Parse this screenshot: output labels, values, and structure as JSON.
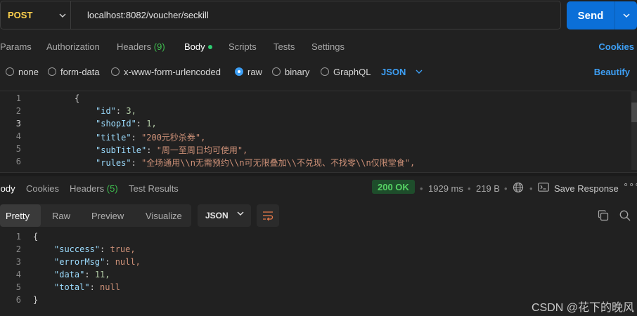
{
  "request": {
    "method": "POST",
    "url": "localhost:8082/voucher/seckill",
    "send_label": "Send"
  },
  "request_tabs": {
    "params": "Params",
    "authorization": "Authorization",
    "headers": "Headers",
    "headers_count": "(9)",
    "body": "Body",
    "scripts": "Scripts",
    "tests": "Tests",
    "settings": "Settings",
    "cookies": "Cookies"
  },
  "body_types": {
    "none": "none",
    "form_data": "form-data",
    "urlencoded": "x-www-form-urlencoded",
    "raw": "raw",
    "binary": "binary",
    "graphql": "GraphQL",
    "format": "JSON",
    "beautify": "Beautify",
    "selected": "raw"
  },
  "request_body": {
    "line_numbers": [
      "1",
      "2",
      "3",
      "4",
      "5",
      "6"
    ],
    "open_brace": "{",
    "fields": [
      {
        "key": "\"id\"",
        "value": "3,",
        "type": "number"
      },
      {
        "key": "\"shopId\"",
        "value": "1,",
        "type": "number"
      },
      {
        "key": "\"title\"",
        "value": "\"200元秒杀券\",",
        "type": "string"
      },
      {
        "key": "\"subTitle\"",
        "value": "\"周一至周日均可使用\",",
        "type": "string"
      },
      {
        "key": "\"rules\"",
        "value": "\"全场通用\\\\n无需预约\\\\n可无限叠加\\\\不兑现、不找零\\\\n仅限堂食\",",
        "type": "string"
      }
    ]
  },
  "response_tabs": {
    "body": "Body",
    "cookies": "Cookies",
    "headers": "Headers",
    "headers_count": "(5)",
    "test_results": "Test Results"
  },
  "response_meta": {
    "status": "200 OK",
    "time": "1929 ms",
    "size": "219 B",
    "save_response": "Save Response",
    "more": "∘∘∘"
  },
  "response_view": {
    "pretty": "Pretty",
    "raw": "Raw",
    "preview": "Preview",
    "visualize": "Visualize",
    "format": "JSON"
  },
  "response_body": {
    "line_numbers": [
      "1",
      "2",
      "3",
      "4",
      "5",
      "6"
    ],
    "open_brace": "{",
    "close_brace": "}",
    "fields": [
      {
        "key": "\"success\"",
        "value": "true,"
      },
      {
        "key": "\"errorMsg\"",
        "value": "null,"
      },
      {
        "key": "\"data\"",
        "value": "11,"
      },
      {
        "key": "\"total\"",
        "value": "null"
      }
    ]
  },
  "watermark": "CSDN @花下的晚风",
  "colors": {
    "accent": "#0b6fd8",
    "method": "#ffd24d",
    "status_ok": "#56d364",
    "link": "#3d9ff5"
  }
}
